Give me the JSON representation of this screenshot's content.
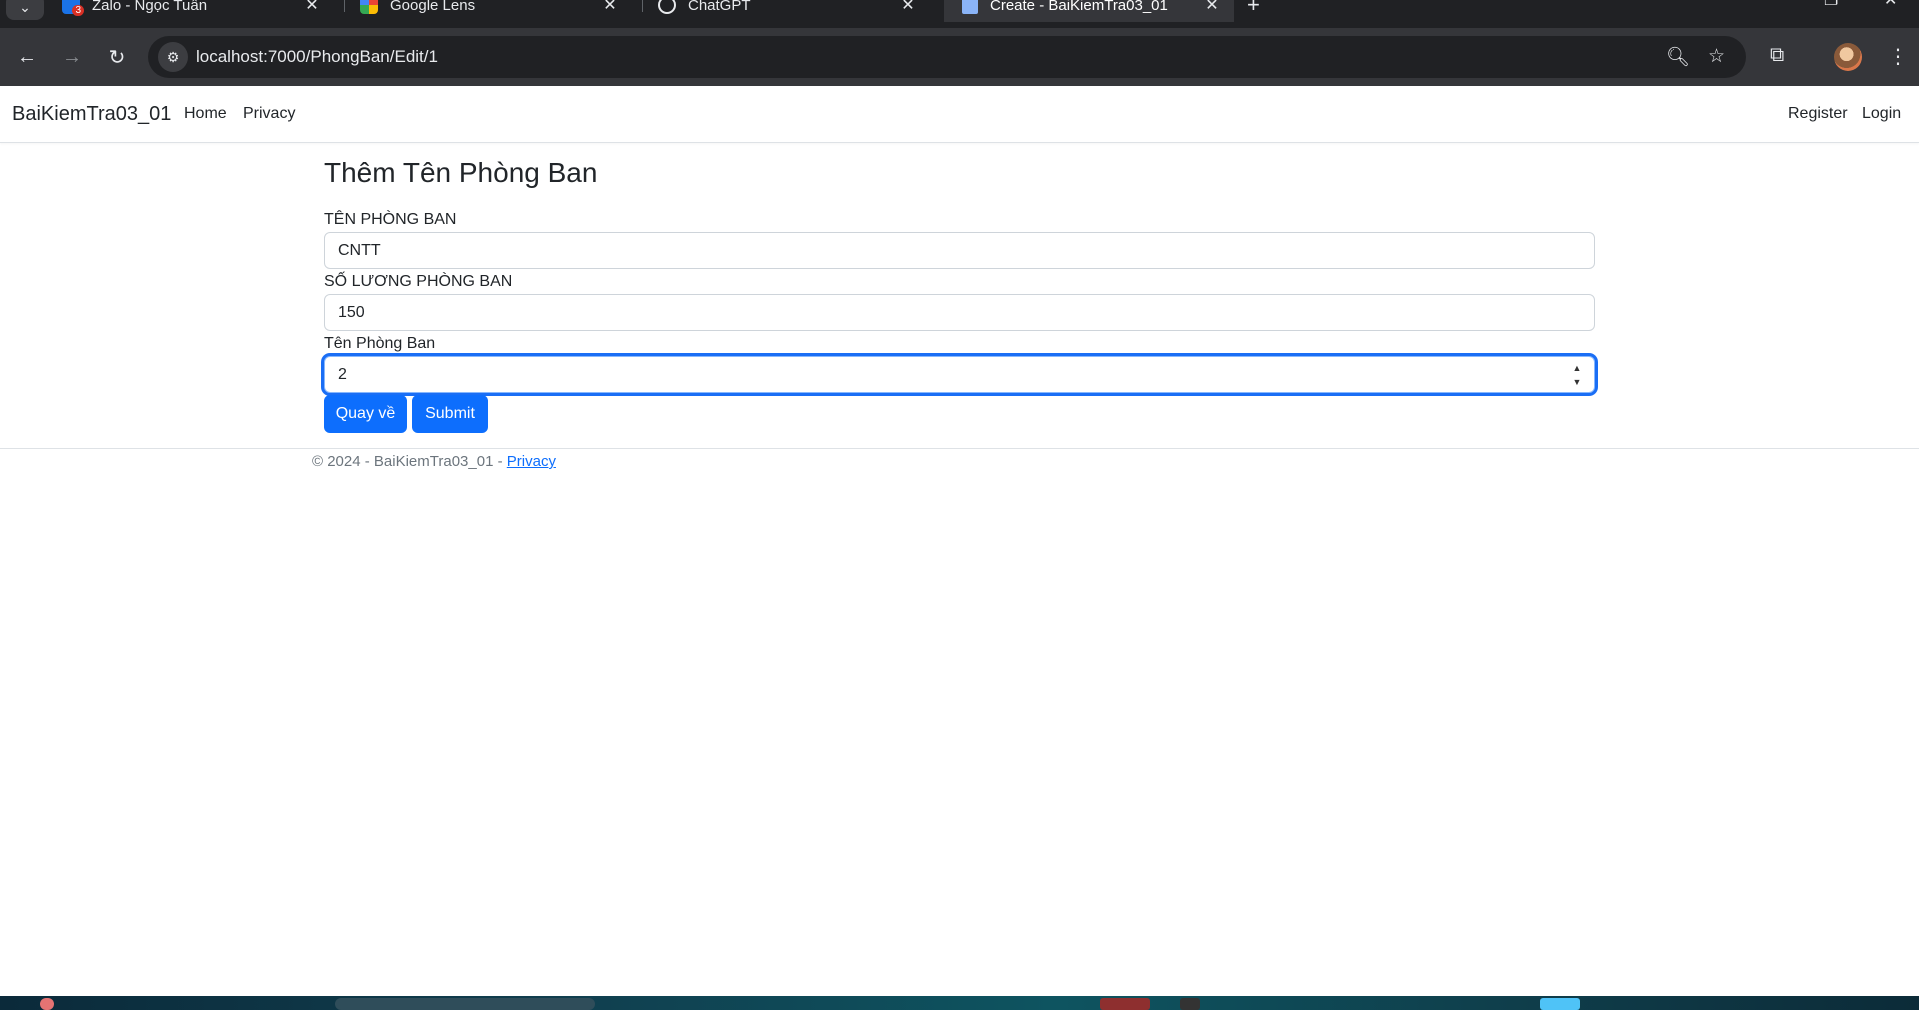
{
  "browser": {
    "tabs": [
      {
        "title": "Zalo - Ngọc Tuấn",
        "badge": "3",
        "favicon_color": "#1a73e8",
        "active": false
      },
      {
        "title": "Google Lens",
        "favicon_color": "#ea4335",
        "active": false
      },
      {
        "title": "ChatGPT",
        "favicon_color": "#e8eaed",
        "active": false
      },
      {
        "title": "Create - BaiKiemTra03_01",
        "favicon_color": "#8ab4f8",
        "active": true
      }
    ],
    "url": "localhost:7000/PhongBan/Edit/1",
    "icons": {
      "back": "back-arrow-icon",
      "forward": "forward-arrow-icon",
      "reload": "reload-icon",
      "site_info": "site-info-icon",
      "zoom": "zoom-icon",
      "bookmark": "star-icon",
      "extensions": "puzzle-icon",
      "menu": "kebab-menu-icon"
    }
  },
  "site": {
    "brand": "BaiKiemTra03_01",
    "nav_left": [
      "Home",
      "Privacy"
    ],
    "nav_right": [
      "Register",
      "Login"
    ]
  },
  "form": {
    "title": "Thêm Tên Phòng Ban",
    "fields": [
      {
        "label": "TÊN PHÒNG BAN",
        "value": "CNTT",
        "type": "text"
      },
      {
        "label": "SỐ LƯƠNG PHÒNG BAN",
        "value": "150",
        "type": "text"
      },
      {
        "label": "Tên Phòng Ban",
        "value": "2",
        "type": "number",
        "focused": true
      }
    ],
    "buttons": {
      "back": "Quay về",
      "submit": "Submit"
    }
  },
  "footer": {
    "text": "© 2024 - BaiKiemTra03_01 - ",
    "link": "Privacy"
  },
  "colors": {
    "primary": "#0d6efd",
    "focus_ring": "#1a6ef5",
    "browser_dark": "#202124",
    "browser_toolbar": "#35363a"
  }
}
